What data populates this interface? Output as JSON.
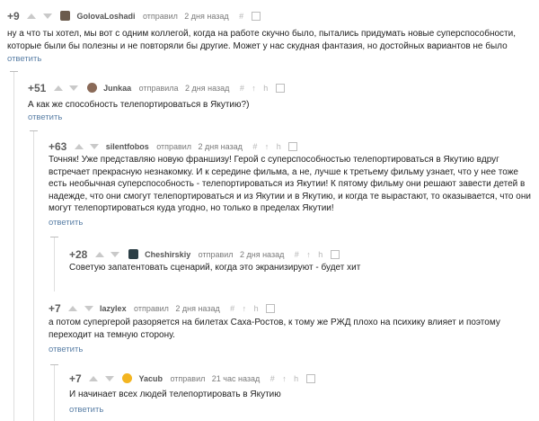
{
  "ui": {
    "sent_label_f": "отправила",
    "sent_label_m": "отправил",
    "reply_label": "ответить",
    "icons": [
      "arrow-up-icon",
      "arrow-down-icon",
      "hash-icon",
      "pin-icon",
      "link-icon",
      "save-icon"
    ],
    "accent_color": "#5a7fa6"
  },
  "comments": [
    {
      "rating": "+9",
      "author": "GolovaLoshadi",
      "sent": "отправил",
      "time": "2 дня назад",
      "text": "ну а что ты хотел, мы вот с одним коллегой, когда на работе скучно было, пытались придумать новые суперспособности, которые были бы полезны и не повторяли бы другие. Может у нас скудная фантазия, но достойных вариантов не было",
      "reply": "ответить"
    },
    {
      "rating": "+51",
      "author": "Junkaa",
      "sent": "отправила",
      "time": "2 дня назад",
      "text": "А как же способность телепортироваться в Якутию?)",
      "reply": "ответить"
    },
    {
      "rating": "+63",
      "author": "silentfobos",
      "sent": "отправил",
      "time": "2 дня назад",
      "text": "Точняк! Уже представляю новую франшизу! Герой с суперспособностью телепортироваться в Якутию вдруг встречает прекрасную незнакомку. И к середине фильма, а не, лучше к третьему фильму узнает, что у нее тоже есть необычная суперспособность - телепортироваться из Якутии! К пятому фильму они решают завести детей в надежде, что они смогут телепортироваться и из Якутии и в Якутию, и когда те вырастают, то оказывается, что они могут телепортироваться куда угодно, но только в пределах Якутии!",
      "reply": "ответить"
    },
    {
      "rating": "+28",
      "author": "Cheshirskiy",
      "sent": "отправил",
      "time": "2 дня назад",
      "text": "Советую запатентовать сценарий, когда это экранизируют - будет хит",
      "reply": "ответить"
    },
    {
      "rating": "+7",
      "author": "lazylex",
      "sent": "отправил",
      "time": "2 дня назад",
      "text": "а потом супергерой разоряется на билетах Саха-Ростов, к тому же РЖД плохо на психику влияет и поэтому переходит на темную сторону.",
      "reply": "ответить"
    },
    {
      "rating": "+7",
      "author": "Yacub",
      "sent": "отправил",
      "time": "21 час назад",
      "text": "И начинает всех людей телепортировать в Якутию",
      "reply": "ответить"
    }
  ]
}
